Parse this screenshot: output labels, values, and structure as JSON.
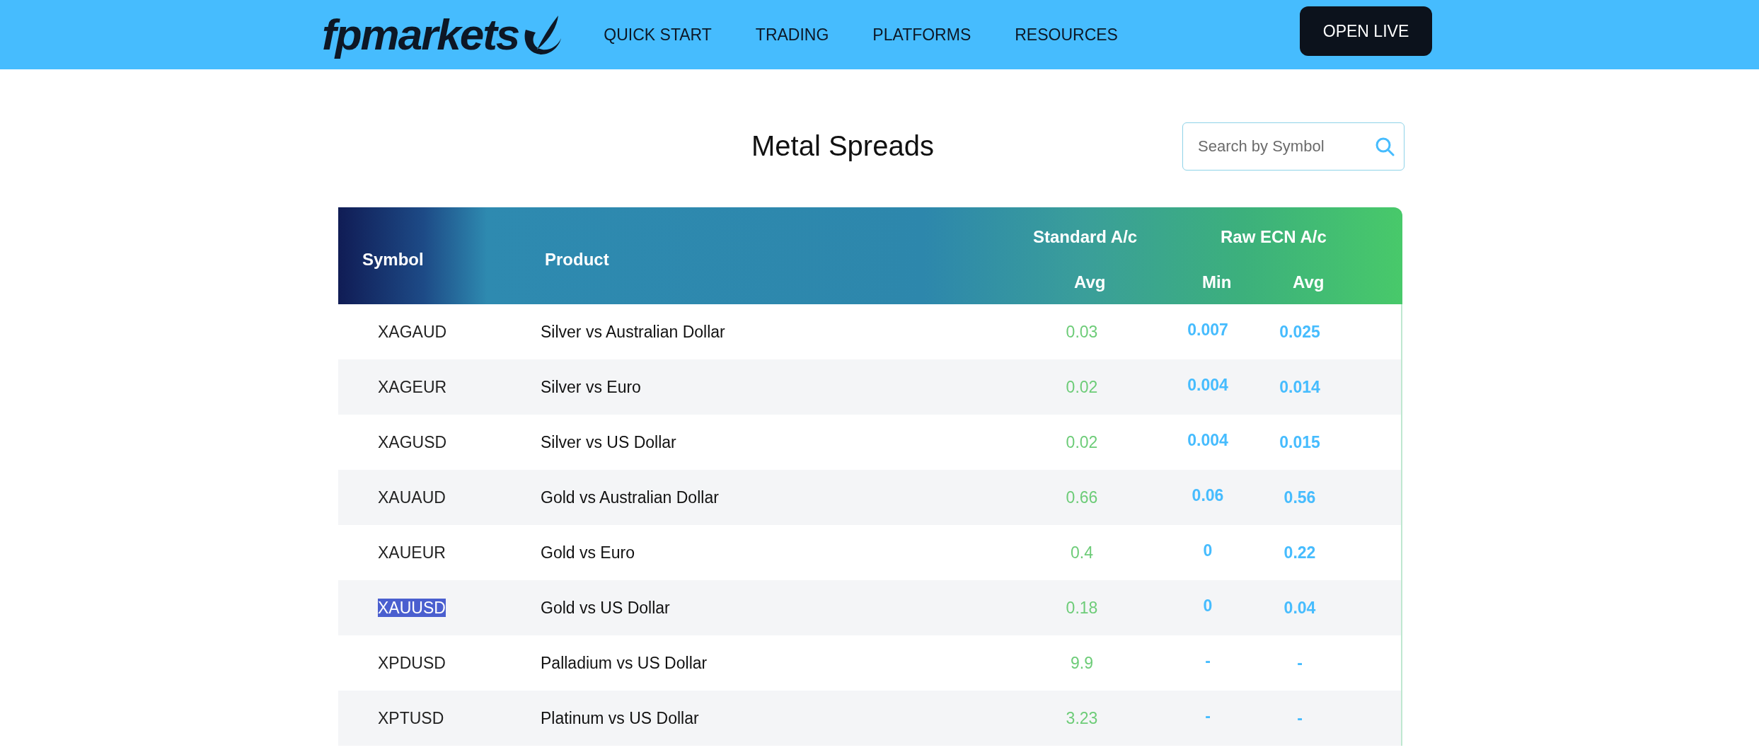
{
  "header": {
    "logo": "fpmarkets",
    "nav": [
      "QUICK START",
      "TRADING",
      "PLATFORMS",
      "RESOURCES"
    ],
    "cta": "OPEN LIVE"
  },
  "title": "Metal Spreads",
  "search": {
    "placeholder": "Search by Symbol"
  },
  "table": {
    "columns": {
      "symbol": "Symbol",
      "product": "Product",
      "standard_group": "Standard A/c",
      "raw_group": "Raw ECN A/c",
      "standard_avg": "Avg",
      "raw_min": "Min",
      "raw_avg": "Avg"
    },
    "rows": [
      {
        "symbol": "XAGAUD",
        "product": "Silver vs Australian Dollar",
        "standard_avg": "0.03",
        "raw_min": "0.007",
        "raw_avg": "0.025",
        "selected": false
      },
      {
        "symbol": "XAGEUR",
        "product": "Silver vs Euro",
        "standard_avg": "0.02",
        "raw_min": "0.004",
        "raw_avg": "0.014",
        "selected": false
      },
      {
        "symbol": "XAGUSD",
        "product": "Silver vs US Dollar",
        "standard_avg": "0.02",
        "raw_min": "0.004",
        "raw_avg": "0.015",
        "selected": false
      },
      {
        "symbol": "XAUAUD",
        "product": "Gold vs Australian Dollar",
        "standard_avg": "0.66",
        "raw_min": "0.06",
        "raw_avg": "0.56",
        "selected": false
      },
      {
        "symbol": "XAUEUR",
        "product": "Gold vs Euro",
        "standard_avg": "0.4",
        "raw_min": "0",
        "raw_avg": "0.22",
        "selected": false
      },
      {
        "symbol": "XAUUSD",
        "product": "Gold vs US Dollar",
        "standard_avg": "0.18",
        "raw_min": "0",
        "raw_avg": "0.04",
        "selected": true
      },
      {
        "symbol": "XPDUSD",
        "product": "Palladium vs US Dollar",
        "standard_avg": "9.9",
        "raw_min": "-",
        "raw_avg": "-",
        "selected": false
      },
      {
        "symbol": "XPTUSD",
        "product": "Platinum vs US Dollar",
        "standard_avg": "3.23",
        "raw_min": "-",
        "raw_avg": "-",
        "selected": false
      }
    ]
  }
}
